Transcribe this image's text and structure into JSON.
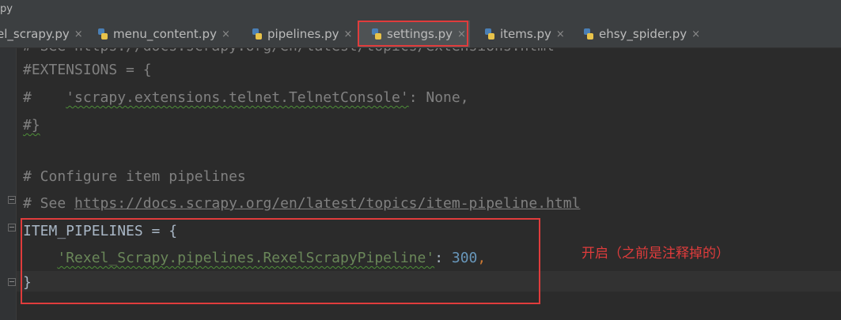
{
  "window": {
    "title_fragment": "py"
  },
  "tabs": [
    {
      "label": "el_scrapy.py",
      "active": false
    },
    {
      "label": "menu_content.py",
      "active": false
    },
    {
      "label": "pipelines.py",
      "active": false
    },
    {
      "label": "settings.py",
      "active": true
    },
    {
      "label": "items.py",
      "active": false
    },
    {
      "label": "ehsy_spider.py",
      "active": false
    }
  ],
  "close_glyph": "×",
  "editor": {
    "line_top_cut": "# See https://docs.scrapy.org/en/latest/topics/extensions.html",
    "ext_open": "#EXTENSIONS = {",
    "ext_entry_hash": "#",
    "ext_entry_key": "'scrapy.extensions.telnet.TelnetConsole'",
    "ext_entry_rest": ": None,",
    "ext_close": "#}",
    "configure_comment": "# Configure item pipelines",
    "see_prefix": "# See ",
    "see_link": "https://docs.scrapy.org/en/latest/topics/item-pipeline.html",
    "pipelines_open": "ITEM_PIPELINES = {",
    "pipeline_key": "'Rexel_Scrapy.pipelines.RexelScrapyPipeline'",
    "pipeline_colon": ": ",
    "pipeline_value": "300",
    "pipeline_comma": ",",
    "pipelines_close": "}"
  },
  "annotation": "开启（之前是注释掉的）",
  "colors": {
    "background": "#2b2b2b",
    "comment": "#808080",
    "string": "#6a8759",
    "number": "#6897bb",
    "highlight_box": "#e03c3c"
  }
}
